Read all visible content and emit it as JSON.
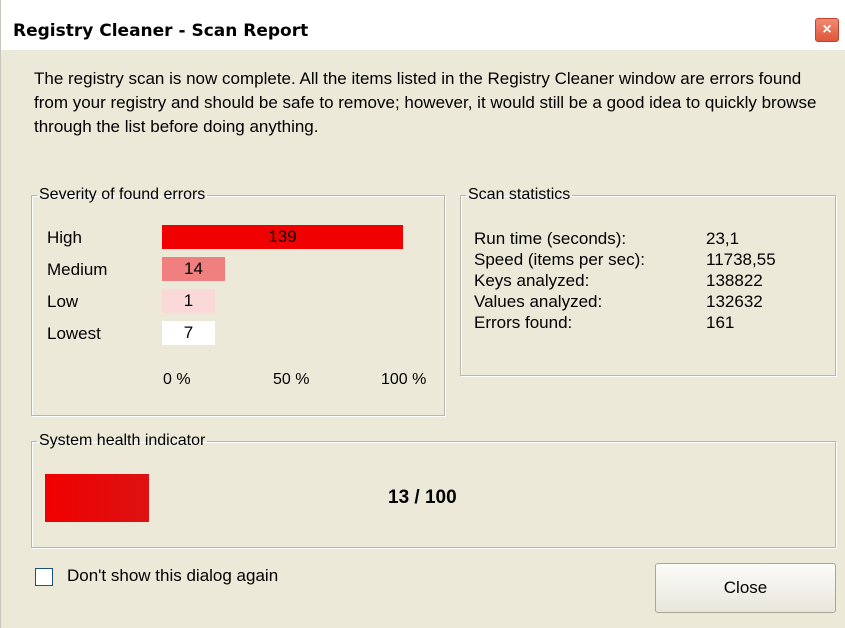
{
  "window": {
    "title": "Registry Cleaner - Scan Report",
    "close_glyph": "×"
  },
  "intro": "The registry scan is now complete. All the items listed in the Registry Cleaner window are errors found from your registry and should be safe to remove; however, it would still be a good idea to quickly browse through the list before doing anything.",
  "severity": {
    "legend": "Severity of found errors",
    "rows": [
      {
        "label": "High",
        "count": "139",
        "fraction": 1.0,
        "color": "#f00000"
      },
      {
        "label": "Medium",
        "count": "14",
        "fraction": 0.26,
        "color": "#f08080"
      },
      {
        "label": "Low",
        "count": "1",
        "fraction": 0.22,
        "color": "#fbd9d9"
      },
      {
        "label": "Lowest",
        "count": "7",
        "fraction": 0.22,
        "color": "#ffffff"
      }
    ],
    "ticks": [
      "0 %",
      "50 %",
      "100 %"
    ]
  },
  "stats": {
    "legend": "Scan statistics",
    "rows": [
      {
        "label": "Run time (seconds):",
        "value": "23,1"
      },
      {
        "label": "Speed (items per sec):",
        "value": "11738,55"
      },
      {
        "label": "Keys analyzed:",
        "value": "138822"
      },
      {
        "label": "Values analyzed:",
        "value": "132632"
      },
      {
        "label": "Errors found:",
        "value": "161"
      }
    ]
  },
  "health": {
    "legend": "System health indicator",
    "score_text": "13 / 100",
    "score": 13,
    "max": 100,
    "color": "#f00000"
  },
  "footer": {
    "checkbox_label": "Don't show this dialog again",
    "checkbox_checked": false,
    "close_label": "Close"
  }
}
